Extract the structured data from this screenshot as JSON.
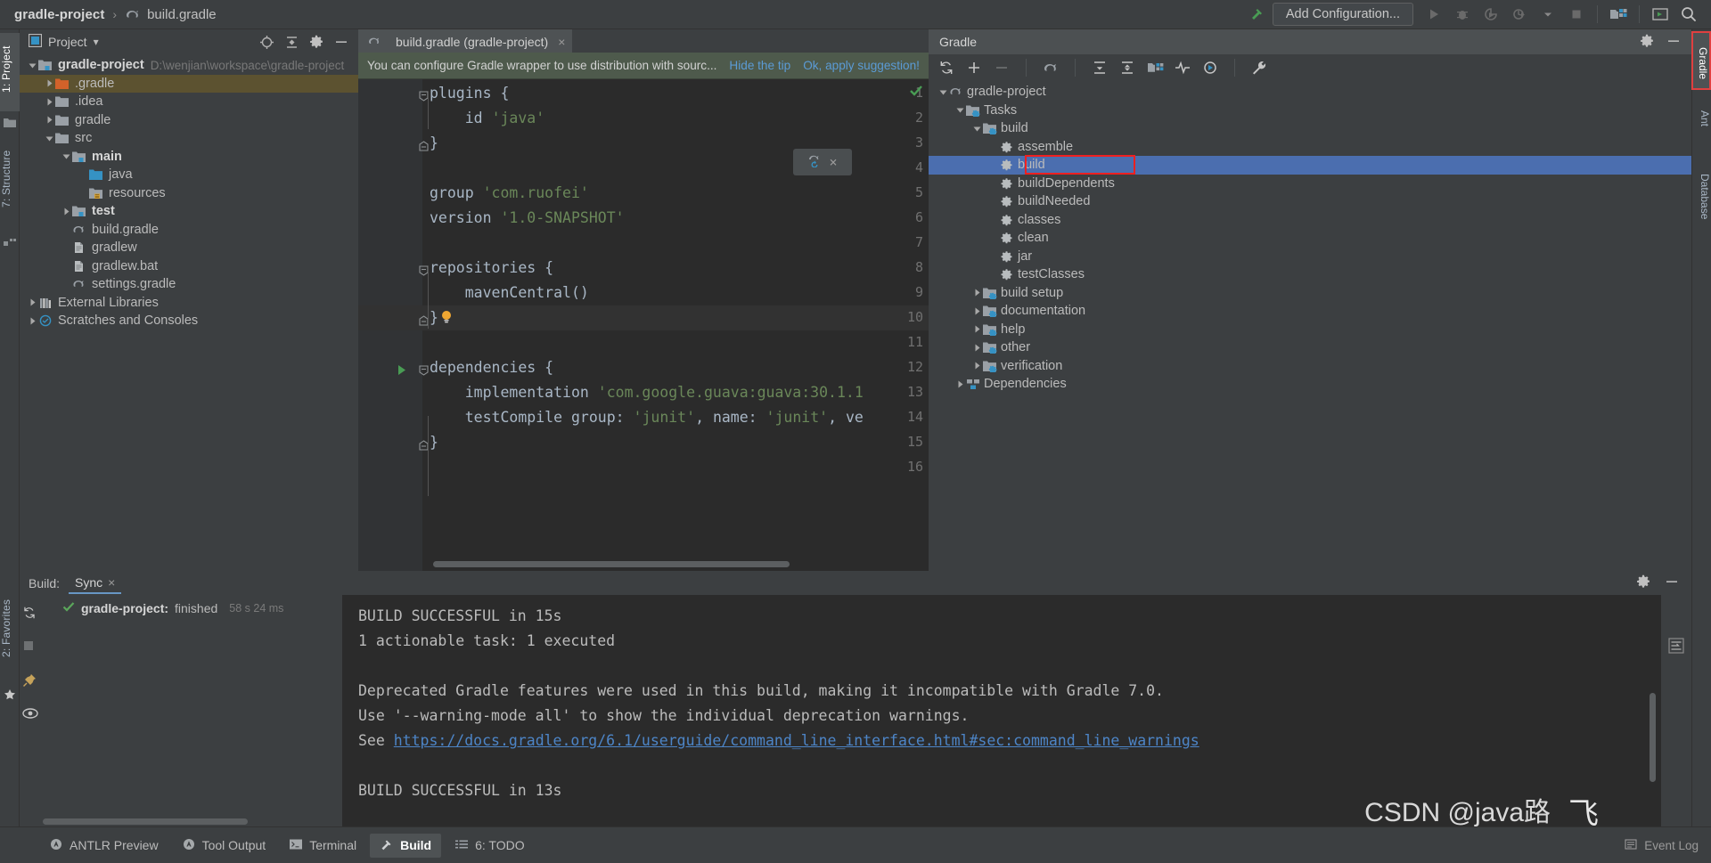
{
  "topbar": {
    "project_name": "gradle-project",
    "separator": "›",
    "file_name": "build.gradle",
    "add_configuration": "Add Configuration...",
    "icons": [
      "build-hammer-icon",
      "run-icon",
      "debug-icon",
      "run-with-coverage-icon",
      "profiler-icon",
      "dropdown-icon",
      "stop-icon",
      "project-structure-icon",
      "search-everywhere-icon",
      "magnifier-icon"
    ]
  },
  "left_strip": {
    "tabs": [
      {
        "label": "1: Project",
        "active": true
      },
      {
        "label": "7: Structure",
        "active": false
      },
      {
        "label": "2: Favorites",
        "active": false
      }
    ],
    "icons": [
      "folder-icon",
      "structure-icon",
      "star-icon"
    ]
  },
  "right_strip": {
    "tabs": [
      {
        "label": "Gradle",
        "active": true
      },
      {
        "label": "Ant",
        "active": false
      },
      {
        "label": "Database",
        "active": false
      }
    ]
  },
  "project_panel": {
    "title": "Project",
    "dropdown": "▾",
    "header_icons": [
      "locate-icon",
      "collapse-all-icon",
      "settings-gear-icon",
      "hide-icon"
    ],
    "tree": [
      {
        "indent": 0,
        "twist": "open",
        "icon": "module-folder-icon",
        "label": "gradle-project",
        "bold": true,
        "path": "D:\\wenjian\\workspace\\gradle-project",
        "selected": false
      },
      {
        "indent": 1,
        "twist": "closed",
        "icon": "excluded-folder-icon",
        "label": ".gradle",
        "bold": false,
        "path": "",
        "selected": true
      },
      {
        "indent": 1,
        "twist": "closed",
        "icon": "folder-icon",
        "label": ".idea",
        "bold": false,
        "path": "",
        "selected": false
      },
      {
        "indent": 1,
        "twist": "closed",
        "icon": "folder-icon",
        "label": "gradle",
        "bold": false,
        "path": "",
        "selected": false
      },
      {
        "indent": 1,
        "twist": "open",
        "icon": "folder-icon",
        "label": "src",
        "bold": false,
        "path": "",
        "selected": false
      },
      {
        "indent": 2,
        "twist": "open",
        "icon": "module-folder-icon",
        "label": "main",
        "bold": true,
        "path": "",
        "selected": false
      },
      {
        "indent": 3,
        "twist": "none",
        "icon": "source-folder-icon",
        "label": "java",
        "bold": false,
        "path": "",
        "selected": false
      },
      {
        "indent": 3,
        "twist": "none",
        "icon": "resources-folder-icon",
        "label": "resources",
        "bold": false,
        "path": "",
        "selected": false
      },
      {
        "indent": 2,
        "twist": "closed",
        "icon": "module-folder-icon",
        "label": "test",
        "bold": true,
        "path": "",
        "selected": false
      },
      {
        "indent": 2,
        "twist": "none",
        "icon": "gradle-file-icon",
        "label": "build.gradle",
        "bold": false,
        "path": "",
        "selected": false
      },
      {
        "indent": 2,
        "twist": "none",
        "icon": "file-icon",
        "label": "gradlew",
        "bold": false,
        "path": "",
        "selected": false
      },
      {
        "indent": 2,
        "twist": "none",
        "icon": "file-icon",
        "label": "gradlew.bat",
        "bold": false,
        "path": "",
        "selected": false
      },
      {
        "indent": 2,
        "twist": "none",
        "icon": "gradle-file-icon",
        "label": "settings.gradle",
        "bold": false,
        "path": "",
        "selected": false
      },
      {
        "indent": 0,
        "twist": "closed",
        "icon": "library-icon",
        "label": "External Libraries",
        "bold": false,
        "path": "",
        "selected": false
      },
      {
        "indent": 0,
        "twist": "closed",
        "icon": "scratch-icon",
        "label": "Scratches and Consoles",
        "bold": false,
        "path": "",
        "selected": false
      }
    ]
  },
  "editor": {
    "tab_label": "build.gradle (gradle-project)",
    "tab_icon": "gradle-file-icon",
    "tab_close": "×",
    "tip": {
      "text": "You can configure Gradle wrapper to use distribution with sourc...",
      "hide_link": "Hide the tip",
      "apply_link": "Ok, apply suggestion!"
    },
    "lines": [
      {
        "n": 1,
        "fold": "open",
        "run": false,
        "segments": [
          {
            "t": "plugins {",
            "c": "plain"
          }
        ],
        "indent": 0
      },
      {
        "n": 2,
        "fold": "none",
        "run": false,
        "segments": [
          {
            "t": "id ",
            "c": "plain"
          },
          {
            "t": "'java'",
            "c": "str"
          }
        ],
        "indent": 1
      },
      {
        "n": 3,
        "fold": "close",
        "run": false,
        "segments": [
          {
            "t": "}",
            "c": "plain"
          }
        ],
        "indent": 0
      },
      {
        "n": 4,
        "fold": "none",
        "run": false,
        "segments": [],
        "indent": 0
      },
      {
        "n": 5,
        "fold": "none",
        "run": false,
        "segments": [
          {
            "t": "group ",
            "c": "plain"
          },
          {
            "t": "'com.ruofei'",
            "c": "str"
          }
        ],
        "indent": 0
      },
      {
        "n": 6,
        "fold": "none",
        "run": false,
        "segments": [
          {
            "t": "version ",
            "c": "plain"
          },
          {
            "t": "'1.0-SNAPSHOT'",
            "c": "str"
          }
        ],
        "indent": 0
      },
      {
        "n": 7,
        "fold": "none",
        "run": false,
        "segments": [],
        "indent": 0
      },
      {
        "n": 8,
        "fold": "open",
        "run": false,
        "segments": [
          {
            "t": "repositories {",
            "c": "plain"
          }
        ],
        "indent": 0
      },
      {
        "n": 9,
        "fold": "none",
        "run": false,
        "segments": [
          {
            "t": "mavenCentral()",
            "c": "plain"
          }
        ],
        "indent": 1
      },
      {
        "n": 10,
        "fold": "close",
        "run": false,
        "segments": [
          {
            "t": "}",
            "c": "plain"
          }
        ],
        "indent": 0,
        "bulb": true,
        "highlight": true
      },
      {
        "n": 11,
        "fold": "none",
        "run": false,
        "segments": [],
        "indent": 0
      },
      {
        "n": 12,
        "fold": "open",
        "run": true,
        "segments": [
          {
            "t": "dependencies {",
            "c": "plain"
          }
        ],
        "indent": 0
      },
      {
        "n": 13,
        "fold": "none",
        "run": false,
        "segments": [
          {
            "t": "implementation ",
            "c": "plain"
          },
          {
            "t": "'com.google.guava:guava:30.1.1",
            "c": "str"
          }
        ],
        "indent": 1
      },
      {
        "n": 14,
        "fold": "none",
        "run": false,
        "segments": [
          {
            "t": "testCompile ",
            "c": "plain"
          },
          {
            "t": "group: ",
            "c": "plain"
          },
          {
            "t": "'junit'",
            "c": "str"
          },
          {
            "t": ", ",
            "c": "plain"
          },
          {
            "t": "name: ",
            "c": "plain"
          },
          {
            "t": "'junit'",
            "c": "str"
          },
          {
            "t": ", ve",
            "c": "plain"
          }
        ],
        "indent": 1
      },
      {
        "n": 15,
        "fold": "close",
        "run": false,
        "segments": [
          {
            "t": "}",
            "c": "plain"
          }
        ],
        "indent": 0
      },
      {
        "n": 16,
        "fold": "none",
        "run": false,
        "segments": [],
        "indent": 0
      }
    ],
    "popup_icons": [
      "gradle-refresh-icon",
      "close-icon"
    ],
    "inspection_status": "ok-check-icon"
  },
  "gradle_panel": {
    "title": "Gradle",
    "header_icons": [
      "settings-gear-icon",
      "hide-icon"
    ],
    "toolbar_icons": [
      "refresh-icon",
      "add-icon",
      "remove-icon",
      "gradle-elephant-icon",
      "expand-all-icon",
      "collapse-all-icon",
      "project-structure-icon",
      "toggle-offline-icon",
      "execute-task-icon",
      "wrench-icon"
    ],
    "tree": [
      {
        "indent": 0,
        "twist": "open",
        "icon": "gradle-elephant-icon",
        "label": "gradle-project",
        "selected": false
      },
      {
        "indent": 1,
        "twist": "open",
        "icon": "task-folder-icon",
        "label": "Tasks",
        "selected": false
      },
      {
        "indent": 2,
        "twist": "open",
        "icon": "task-folder-icon",
        "label": "build",
        "selected": false
      },
      {
        "indent": 3,
        "twist": "none",
        "icon": "gear-task-icon",
        "label": "assemble",
        "selected": false
      },
      {
        "indent": 3,
        "twist": "none",
        "icon": "gear-task-icon",
        "label": "build",
        "selected": true
      },
      {
        "indent": 3,
        "twist": "none",
        "icon": "gear-task-icon",
        "label": "buildDependents",
        "selected": false
      },
      {
        "indent": 3,
        "twist": "none",
        "icon": "gear-task-icon",
        "label": "buildNeeded",
        "selected": false
      },
      {
        "indent": 3,
        "twist": "none",
        "icon": "gear-task-icon",
        "label": "classes",
        "selected": false
      },
      {
        "indent": 3,
        "twist": "none",
        "icon": "gear-task-icon",
        "label": "clean",
        "selected": false
      },
      {
        "indent": 3,
        "twist": "none",
        "icon": "gear-task-icon",
        "label": "jar",
        "selected": false
      },
      {
        "indent": 3,
        "twist": "none",
        "icon": "gear-task-icon",
        "label": "testClasses",
        "selected": false
      },
      {
        "indent": 2,
        "twist": "closed",
        "icon": "task-folder-icon",
        "label": "build setup",
        "selected": false
      },
      {
        "indent": 2,
        "twist": "closed",
        "icon": "task-folder-icon",
        "label": "documentation",
        "selected": false
      },
      {
        "indent": 2,
        "twist": "closed",
        "icon": "task-folder-icon",
        "label": "help",
        "selected": false
      },
      {
        "indent": 2,
        "twist": "closed",
        "icon": "task-folder-icon",
        "label": "other",
        "selected": false
      },
      {
        "indent": 2,
        "twist": "closed",
        "icon": "task-folder-icon",
        "label": "verification",
        "selected": false
      },
      {
        "indent": 1,
        "twist": "closed",
        "icon": "dependencies-icon",
        "label": "Dependencies",
        "selected": false
      }
    ]
  },
  "build_panel": {
    "label": "Build:",
    "tab": "Sync",
    "tab_close": "×",
    "header_icons": [
      "settings-gear-icon",
      "hide-icon"
    ],
    "tool_icons": [
      "rerun-icon",
      "stop-icon",
      "pin-icon",
      "eye-icon"
    ],
    "tree_node": {
      "status_icon": "green-check-icon",
      "project": "gradle-project:",
      "state": "finished",
      "duration": "58 s 24 ms"
    },
    "console_lines": [
      {
        "text": "BUILD SUCCESSFUL in 15s",
        "type": "plain"
      },
      {
        "text": "1 actionable task: 1 executed",
        "type": "plain"
      },
      {
        "text": "",
        "type": "plain"
      },
      {
        "text": "Deprecated Gradle features were used in this build, making it incompatible with Gradle 7.0.",
        "type": "plain"
      },
      {
        "text": "Use '--warning-mode all' to show the individual deprecation warnings.",
        "type": "plain"
      },
      {
        "text": "See ",
        "type": "plain",
        "link": "https://docs.gradle.org/6.1/userguide/command_line_interface.html#sec:command_line_warnings"
      },
      {
        "text": "",
        "type": "plain"
      },
      {
        "text": "BUILD SUCCESSFUL in 13s",
        "type": "plain"
      }
    ]
  },
  "status_bar": {
    "tabs": [
      {
        "label": "ANTLR Preview",
        "icon": "antlr-icon",
        "active": false
      },
      {
        "label": "Tool Output",
        "icon": "antlr-icon",
        "active": false
      },
      {
        "label": "Terminal",
        "icon": "terminal-icon",
        "active": false
      },
      {
        "label": "Build",
        "icon": "build-hammer-icon",
        "active": true
      },
      {
        "label": "6: TODO",
        "icon": "todo-list-icon",
        "active": false
      }
    ],
    "event_log": "Event Log"
  },
  "watermark": {
    "text": "CSDN @java路",
    "logo": "飞"
  },
  "colors": {
    "panel_bg": "#3c3f41",
    "editor_bg": "#2b2b2b",
    "selection_blue": "#4b6eaf",
    "selection_olive": "#5c5230",
    "tip_green": "#4e5a4c",
    "link_blue": "#5b9bd5",
    "highlight_red": "#f02020",
    "string_green": "#6a8759",
    "keyword_orange": "#cc7832"
  }
}
